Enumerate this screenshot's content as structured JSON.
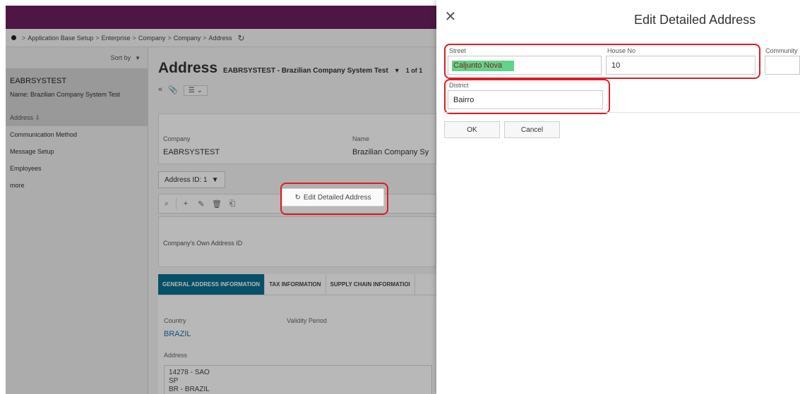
{
  "breadcrumb": {
    "items": [
      "Application Base Setup",
      "Enterprise",
      "Company",
      "Company",
      "Address"
    ]
  },
  "sidebar": {
    "sort_label": "Sort by",
    "record_id": "EABRSYSTEST",
    "record_name": "Name:  Brazilian Company System Test",
    "items": [
      {
        "label": "Address ⇩"
      },
      {
        "label": "Communication Method"
      },
      {
        "label": "Message Setup"
      },
      {
        "label": "Employees"
      },
      {
        "label": "more"
      }
    ]
  },
  "header": {
    "title": "Address",
    "subtitle": "EABRSYSTEST - Brazilian Company System Test",
    "count": "1 of 1"
  },
  "company_card": {
    "company_label": "Company",
    "company_value": "EABRSYSTEST",
    "name_label": "Name",
    "name_value": "Brazilian Company Sy"
  },
  "address_id": "Address ID: 1",
  "actions": {
    "edit_detailed_label": "Edit Detailed Address"
  },
  "own_address_label": "Company's Own Address ID",
  "tabs": [
    {
      "label": "GENERAL ADDRESS INFORMATION"
    },
    {
      "label": "TAX INFORMATION"
    },
    {
      "label": "SUPPLY CHAIN INFORMATIOI"
    }
  ],
  "general": {
    "country_label": "Country",
    "validity_label": "Validity Period",
    "country_value": "BRAZIL",
    "address_label": "Address",
    "address_lines": [
      "14278 - SAO",
      "SP",
      "BR - BRAZIL"
    ]
  },
  "dialog": {
    "title": "Edit Detailed Address",
    "street_label": "Street",
    "street_value": "Caljunto Nova",
    "house_label": "House No",
    "house_value": "10",
    "community_label": "Community",
    "community_value": "",
    "district_label": "District",
    "district_value": "Bairro",
    "ok_label": "OK",
    "cancel_label": "Cancel"
  },
  "colors": {
    "topbar": "#6b1f5e",
    "highlight_box": "#e01b24",
    "active_tab": "#0b6f8f",
    "selection": "#5fd38a"
  }
}
